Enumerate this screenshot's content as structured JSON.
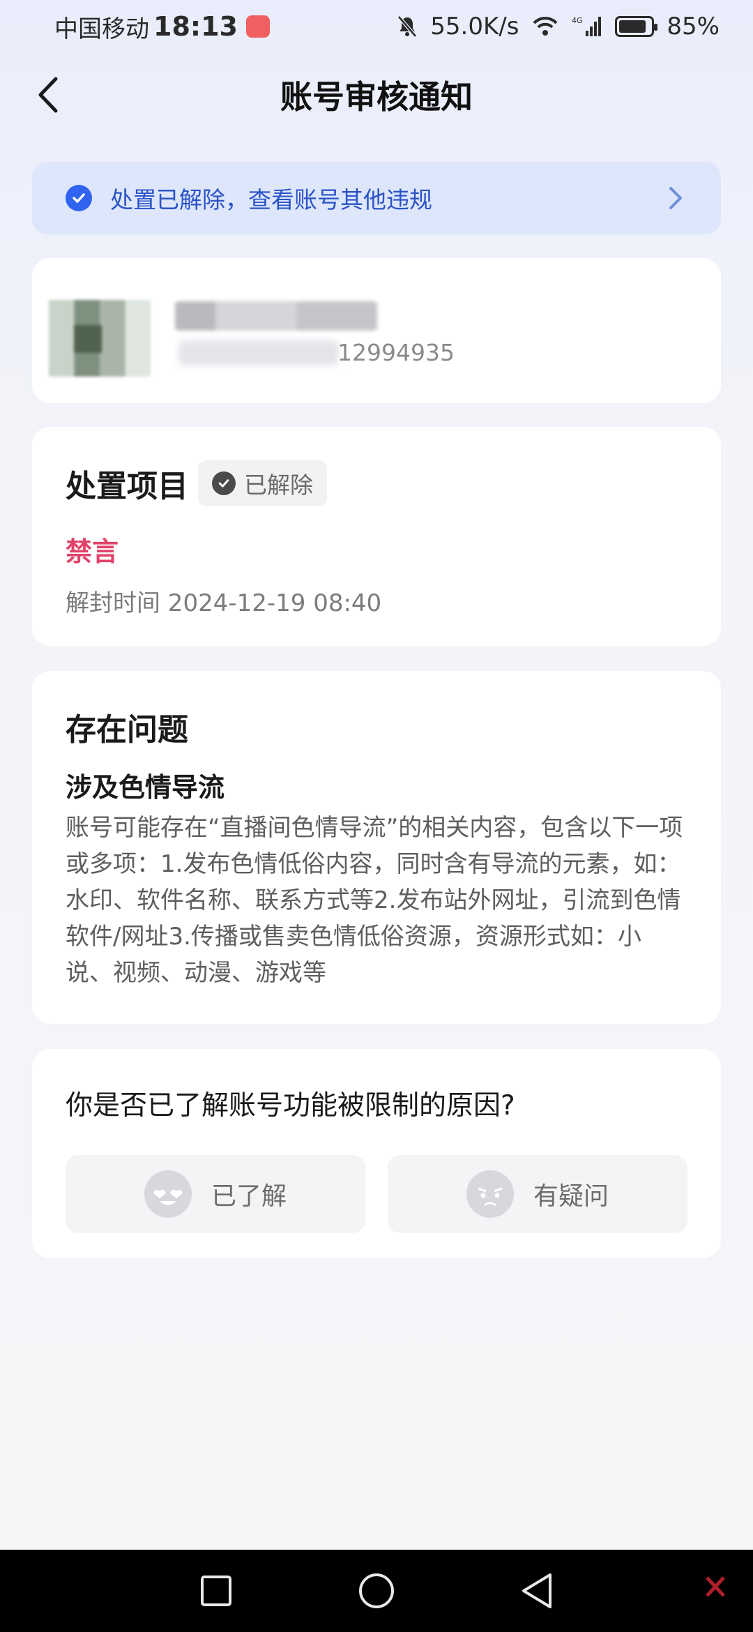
{
  "status_bar": {
    "carrier": "中国移动",
    "time": "18:13",
    "net_speed": "55.0K/s",
    "network_type": "4G",
    "battery_percent": "85%",
    "battery_level": 0.85
  },
  "header": {
    "title": "账号审核通知"
  },
  "banner": {
    "text": "处置已解除，查看账号其他违规"
  },
  "account": {
    "id_partial": "12994935"
  },
  "disposal": {
    "heading": "处置项目",
    "status_chip": "已解除",
    "penalty": "禁言",
    "unban_time": "解封时间 2024-12-19 08:40"
  },
  "issue": {
    "heading": "存在问题",
    "title": "涉及色情导流",
    "description": "账号可能存在“直播间色情导流”的相关内容，包含以下一项或多项：1.发布色情低俗内容，同时含有导流的元素，如：水印、软件名称、联系方式等2.发布站外网址，引流到色情软件/网址3.传播或售卖色情低俗资源，资源形式如：小说、视频、动漫、游戏等"
  },
  "feedback": {
    "question": "你是否已了解账号功能被限制的原因?",
    "understood_label": "已了解",
    "question_label": "有疑问"
  },
  "colors": {
    "accent_blue": "#2f63f0",
    "banner_bg": "#dde6fb",
    "penalty_red": "#e2436a"
  },
  "icons": {
    "back": "chevron-left-icon",
    "banner_check": "check-circle-icon",
    "banner_arrow": "chevron-right-icon",
    "chip_check": "check-circle-icon",
    "understood": "heart-eyes-emoji-icon",
    "question": "frown-emoji-icon"
  }
}
